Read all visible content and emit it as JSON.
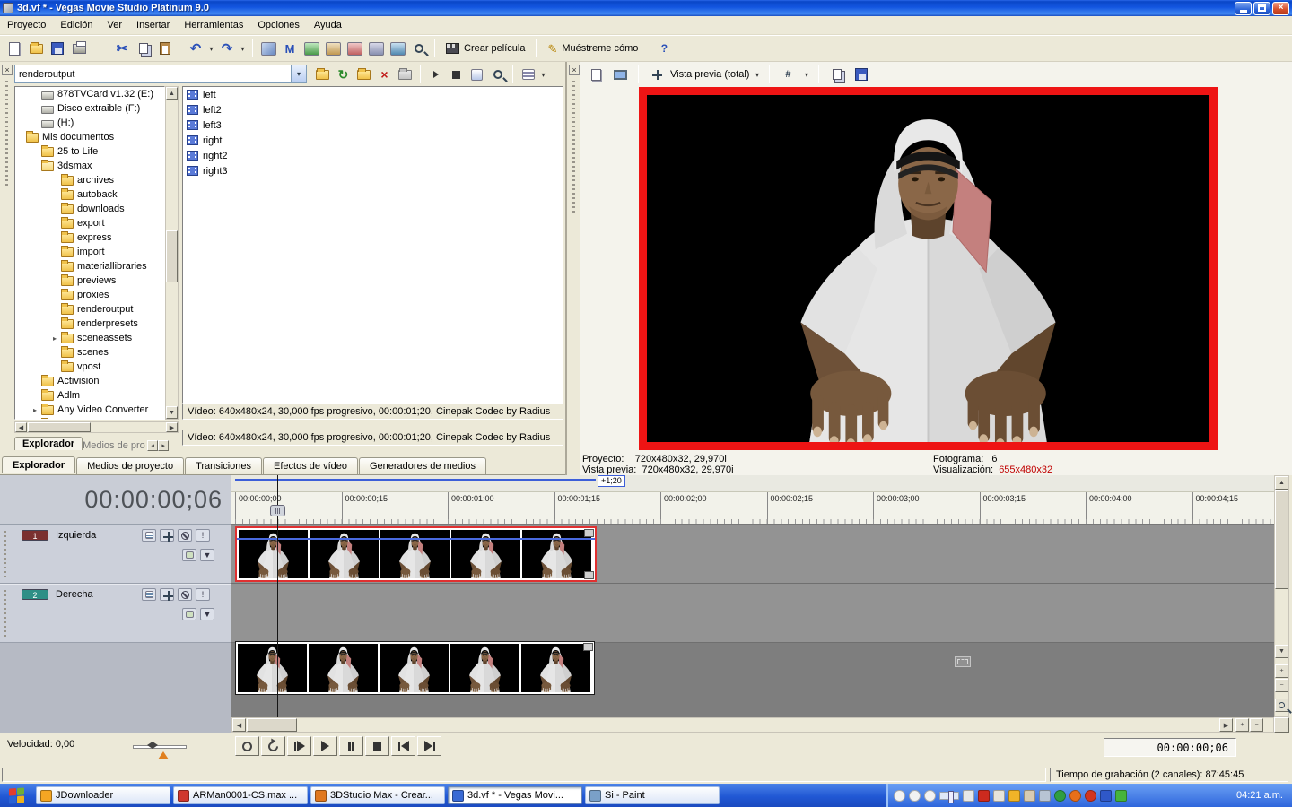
{
  "window": {
    "title": "3d.vf * - Vegas Movie Studio Platinum 9.0"
  },
  "glyphs": {
    "close": "×",
    "caret": "▾",
    "cut": "✂",
    "undo": "↶",
    "redo": "↷",
    "refresh": "↻",
    "delete": "×",
    "pencil": "✎",
    "help": "?",
    "hash": "#",
    "left": "◀",
    "right": "▶",
    "up": "▲",
    "down": "▼",
    "plus": "+",
    "minus": "−",
    "solo": "!",
    "m_tool": "M",
    "pin": "⚑",
    "tab_prev": "◂",
    "tab_next": "▸",
    "up_small": "▴"
  },
  "menu": {
    "items": [
      "Proyecto",
      "Edición",
      "Ver",
      "Insertar",
      "Herramientas",
      "Opciones",
      "Ayuda"
    ]
  },
  "toolbar": {
    "crear_pelicula": "Crear película",
    "muestreme_como": "Muéstreme cómo"
  },
  "explorer": {
    "path_value": "renderoutput",
    "tree": [
      {
        "label": "878TVCard v1.32 (E:)",
        "level": 1,
        "icon": "drive"
      },
      {
        "label": "Disco extraible (F:)",
        "level": 1,
        "icon": "drive"
      },
      {
        "label": "(H:)",
        "level": 1,
        "icon": "drive"
      },
      {
        "label": "Mis documentos",
        "level": 0,
        "icon": "folder"
      },
      {
        "label": "25 to Life",
        "level": 1,
        "icon": "folder"
      },
      {
        "label": "3dsmax",
        "level": 1,
        "icon": "folder-open"
      },
      {
        "label": "archives",
        "level": 2,
        "icon": "folder"
      },
      {
        "label": "autoback",
        "level": 2,
        "icon": "folder"
      },
      {
        "label": "downloads",
        "level": 2,
        "icon": "folder"
      },
      {
        "label": "export",
        "level": 2,
        "icon": "folder"
      },
      {
        "label": "express",
        "level": 2,
        "icon": "folder"
      },
      {
        "label": "import",
        "level": 2,
        "icon": "folder"
      },
      {
        "label": "materiallibraries",
        "level": 2,
        "icon": "folder"
      },
      {
        "label": "previews",
        "level": 2,
        "icon": "folder"
      },
      {
        "label": "proxies",
        "level": 2,
        "icon": "folder"
      },
      {
        "label": "renderoutput",
        "level": 2,
        "icon": "folder"
      },
      {
        "label": "renderpresets",
        "level": 2,
        "icon": "folder"
      },
      {
        "label": "sceneassets",
        "level": 2,
        "icon": "folder",
        "arrow": true
      },
      {
        "label": "scenes",
        "level": 2,
        "icon": "folder"
      },
      {
        "label": "vpost",
        "level": 2,
        "icon": "folder"
      },
      {
        "label": "Activision",
        "level": 1,
        "icon": "folder"
      },
      {
        "label": "Adlm",
        "level": 1,
        "icon": "folder"
      },
      {
        "label": "Any Video Converter",
        "level": 1,
        "icon": "folder",
        "arrow": true
      },
      {
        "label": "Aspyr",
        "level": 1,
        "icon": "folder"
      }
    ],
    "files": [
      {
        "label": "left"
      },
      {
        "label": "left2"
      },
      {
        "label": "left3"
      },
      {
        "label": "right"
      },
      {
        "label": "right2"
      },
      {
        "label": "right3"
      }
    ],
    "video_info": "Vídeo: 640x480x24, 30,000 fps progresivo, 00:00:01;20, Cinepak Codec by Radius",
    "video_info2": "Vídeo: 640x480x24, 30,000 fps progresivo, 00:00:01;20, Cinepak Codec by Radius",
    "mini_tab_active": "Explorador",
    "mini_tab_next": "Medios de prove",
    "tabs": [
      {
        "label": "Explorador",
        "active": true
      },
      {
        "label": "Medios de proyecto"
      },
      {
        "label": "Transiciones"
      },
      {
        "label": "Efectos de vídeo"
      },
      {
        "label": "Generadores de medios"
      }
    ]
  },
  "preview": {
    "view_label": "Vista previa (total)",
    "status": {
      "proyecto_label": "Proyecto:",
      "proyecto_value": "720x480x32, 29,970i",
      "vista_label": "Vista previa:",
      "vista_value": "720x480x32, 29,970i",
      "fotograma_label": "Fotograma:",
      "fotograma_value": "6",
      "visualizacion_label": "Visualización:",
      "visualizacion_value": "655x480x32"
    }
  },
  "timeline": {
    "big_time": "00:00:00;06",
    "loop_label": "+1;20",
    "ruler_ticks": [
      {
        "label": "00:00:00;00"
      },
      {
        "label": "00:00:00;15"
      },
      {
        "label": "00:00:01;00"
      },
      {
        "label": "00:00:01;15"
      },
      {
        "label": "00:00:02;00"
      },
      {
        "label": "00:00:02;15"
      },
      {
        "label": "00:00:03;00"
      },
      {
        "label": "00:00:03;15"
      },
      {
        "label": "00:00:04;00"
      },
      {
        "label": "00:00:04;15"
      }
    ],
    "tracks": [
      {
        "num": "1",
        "name": "Izquierda",
        "chip_color": "#7a3030"
      },
      {
        "num": "2",
        "name": "Derecha",
        "chip_color": "#2e8f86"
      }
    ]
  },
  "transport": {
    "time_readout": "00:00:00;06"
  },
  "bottom": {
    "velocidad": "Velocidad: 0,00",
    "record_status": "Tiempo de grabación (2 canales): 87:45:45"
  },
  "taskbar": {
    "items": [
      {
        "label": "JDownloader",
        "icon_color": "#f5a623"
      },
      {
        "label": "ARMan0001-CS.max ...",
        "icon_color": "#d0382e"
      },
      {
        "label": "3DStudio Max - Crear...",
        "icon_color": "#e07820"
      },
      {
        "label": "3d.vf * - Vegas Movi...",
        "icon_color": "#3a6ad4",
        "active": true
      },
      {
        "label": "Si - Paint",
        "icon_color": "#7aa0c8"
      }
    ],
    "tray_icons": [
      {
        "name": "tray-media-prev",
        "color": "#f2f2f2",
        "shape": "circle"
      },
      {
        "name": "tray-media-pause",
        "color": "#f2f2f2",
        "shape": "circle"
      },
      {
        "name": "tray-media-next",
        "color": "#f2f2f2",
        "shape": "circle"
      },
      {
        "name": "tray-volume-slider",
        "color": "#dfe8f8",
        "shape": "slider"
      },
      {
        "name": "tray-speaker",
        "color": "#e8e8e8",
        "shape": "square"
      },
      {
        "name": "tray-icon-red",
        "color": "#cc2a1e",
        "shape": "square"
      },
      {
        "name": "tray-icon-gray",
        "color": "#e8e4da",
        "shape": "square"
      },
      {
        "name": "tray-icon-yellow",
        "color": "#f0b428",
        "shape": "square"
      },
      {
        "name": "tray-icon-beige",
        "color": "#d8cbb2",
        "shape": "square"
      },
      {
        "name": "tray-icon-printer",
        "color": "#b8c4d4",
        "shape": "square"
      },
      {
        "name": "tray-icon-green",
        "color": "#2f9e41",
        "shape": "circle"
      },
      {
        "name": "tray-icon-orange",
        "color": "#e86f1a",
        "shape": "circle"
      },
      {
        "name": "tray-icon-red2",
        "color": "#d2351f",
        "shape": "circle"
      },
      {
        "name": "tray-icon-blue",
        "color": "#2f58c8",
        "shape": "square"
      },
      {
        "name": "tray-icon-greenarrow",
        "color": "#46b43c",
        "shape": "square"
      }
    ],
    "clock": "04:21 a.m."
  }
}
